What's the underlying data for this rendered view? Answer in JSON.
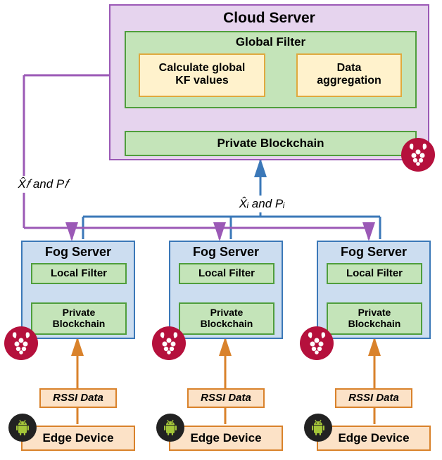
{
  "cloud": {
    "title": "Cloud Server",
    "global_filter": "Global Filter",
    "calc_kf": "Calculate global\nKF values",
    "data_agg": "Data\naggregation",
    "private_bc": "Private Blockchain"
  },
  "edge_label_xf": "X̂𝑓 and P𝑓",
  "edge_label_xi": "X̂ᵢ and Pᵢ",
  "fog": {
    "title": "Fog Server",
    "local_filter": "Local Filter",
    "private_bc": "Private\nBlockchain"
  },
  "rssi": "RSSI Data",
  "edge_device": "Edge Device",
  "icons": {
    "raspberry": "raspberry-pi-icon",
    "android": "android-icon"
  },
  "colors": {
    "purple_border": "#9B59B6",
    "purple_fill": "#E6D4EE",
    "green_border": "#4F9E3C",
    "green_fill": "#C4E4B9",
    "yellow_border": "#E0A93E",
    "yellow_fill": "#FFF2CC",
    "blue_border": "#3B78B8",
    "blue_fill": "#CCDDF0",
    "orange_border": "#D9822B",
    "orange_fill": "#FCE2C7",
    "rpi": "#B5103C",
    "android_bg": "#222222",
    "android_fg": "#A4C639"
  }
}
